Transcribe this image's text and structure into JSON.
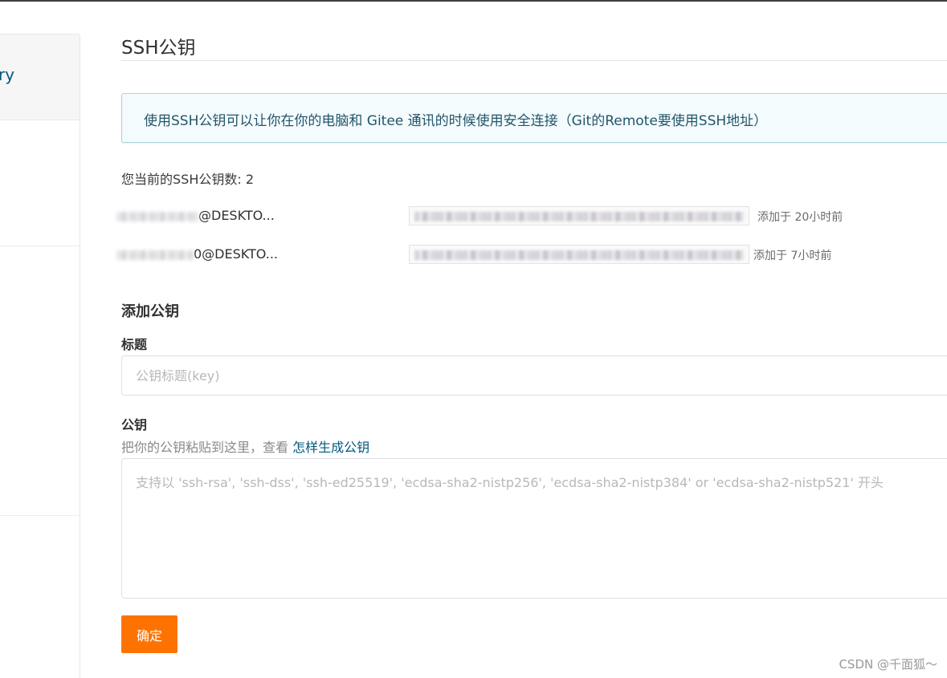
{
  "sidebar": {
    "header_text": "ry"
  },
  "page": {
    "title": "SSH公钥",
    "info": "使用SSH公钥可以让你在你的电脑和 Gitee 通讯的时候使用安全连接（Git的Remote要使用SSH地址）",
    "key_count_label": "您当前的SSH公钥数: 2"
  },
  "keys": [
    {
      "name_suffix": "@DESKTO...",
      "added": "添加于 20小时前"
    },
    {
      "name_suffix": "0@DESKTO...",
      "added": "添加于 7小时前"
    }
  ],
  "form": {
    "heading": "添加公钥",
    "title_label": "标题",
    "title_placeholder": "公钥标题(key)",
    "title_value": "",
    "key_label": "公钥",
    "hint_prefix": "把你的公钥粘贴到这里，查看",
    "hint_link": "怎样生成公钥",
    "key_placeholder": "支持以 'ssh-rsa', 'ssh-dss', 'ssh-ed25519', 'ecdsa-sha2-nistp256', 'ecdsa-sha2-nistp384' or 'ecdsa-sha2-nistp521' 开头",
    "key_value": "",
    "submit_label": "确定"
  },
  "watermark": "CSDN @千面狐～",
  "colors": {
    "accent": "#fe7300",
    "link": "#005980",
    "info_border": "#a9d5e0",
    "info_bg": "#f4fbfd"
  }
}
